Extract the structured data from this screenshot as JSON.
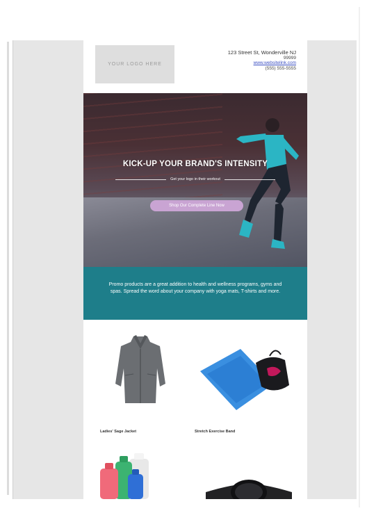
{
  "header": {
    "logo_text": "YOUR LOGO HERE",
    "address_line1": "123 Street St, Wonderville NJ",
    "address_line2": "99999",
    "website": "www.websitelink.com",
    "phone": "(555) 555-5555"
  },
  "hero": {
    "title": "KICK-UP YOUR BRAND'S INTENSITY",
    "subtitle": "Get your logo in their workout",
    "button_label": "Shop Our Complete Line Now"
  },
  "promo": {
    "text": "Promo products are a great addition to health and wellness programs, gyms and spas. Spread the word about your company with yoga mats, T-shirts and more."
  },
  "products": [
    {
      "name": "Ladies' Sage Jacket",
      "icon": "jacket-icon"
    },
    {
      "name": "Stretch Exercise Band",
      "icon": "exercise-band-icon"
    },
    {
      "name": "",
      "icon": "water-bottles-icon"
    },
    {
      "name": "",
      "icon": "fitness-watch-icon"
    }
  ],
  "colors": {
    "page_bg": "#e6e6e6",
    "teal": "#1e7e8a",
    "button": "#c9a4d3",
    "link": "#3a4ec2"
  }
}
